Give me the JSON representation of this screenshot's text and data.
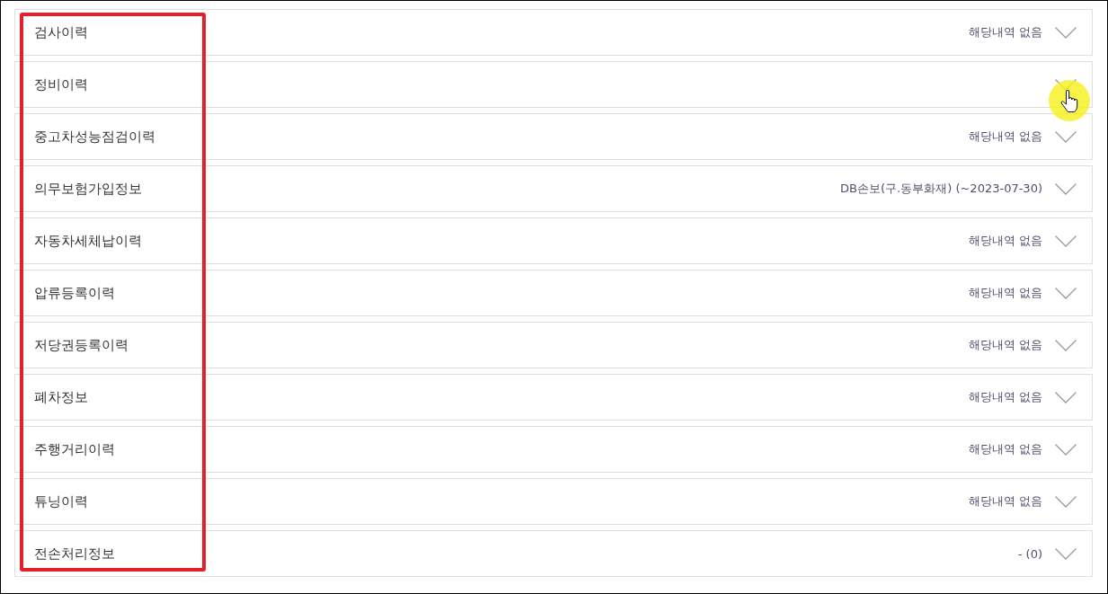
{
  "sections": [
    {
      "title": "검사이력",
      "status": "해당내역 없음",
      "expanded": false,
      "hovered": false
    },
    {
      "title": "정비이력",
      "expanded": false,
      "hovered": true
    },
    {
      "title": "중고차성능점검이력",
      "status": "해당내역 없음",
      "expanded": false,
      "hovered": false
    },
    {
      "title": "의무보험가입정보",
      "status": "DB손보(구.동부화재) (~2023-07-30)",
      "expanded": false,
      "hovered": false
    },
    {
      "title": "자동차세체납이력",
      "status": "해당내역 없음",
      "expanded": false,
      "hovered": false
    },
    {
      "title": "압류등록이력",
      "status": "해당내역 없음",
      "expanded": false,
      "hovered": false
    },
    {
      "title": "저당권등록이력",
      "status": "해당내역 없음",
      "expanded": false,
      "hovered": false
    },
    {
      "title": "폐차정보",
      "status": "해당내역 없음",
      "expanded": false,
      "hovered": false
    },
    {
      "title": "주행거리이력",
      "status": "해당내역 없음",
      "expanded": false,
      "hovered": false
    },
    {
      "title": "튜닝이력",
      "status": "해당내역 없음",
      "expanded": false,
      "hovered": false
    },
    {
      "title": "전손처리정보",
      "status": "- (0)",
      "expanded": false,
      "hovered": false
    }
  ],
  "annotation": {
    "kind": "frame"
  }
}
